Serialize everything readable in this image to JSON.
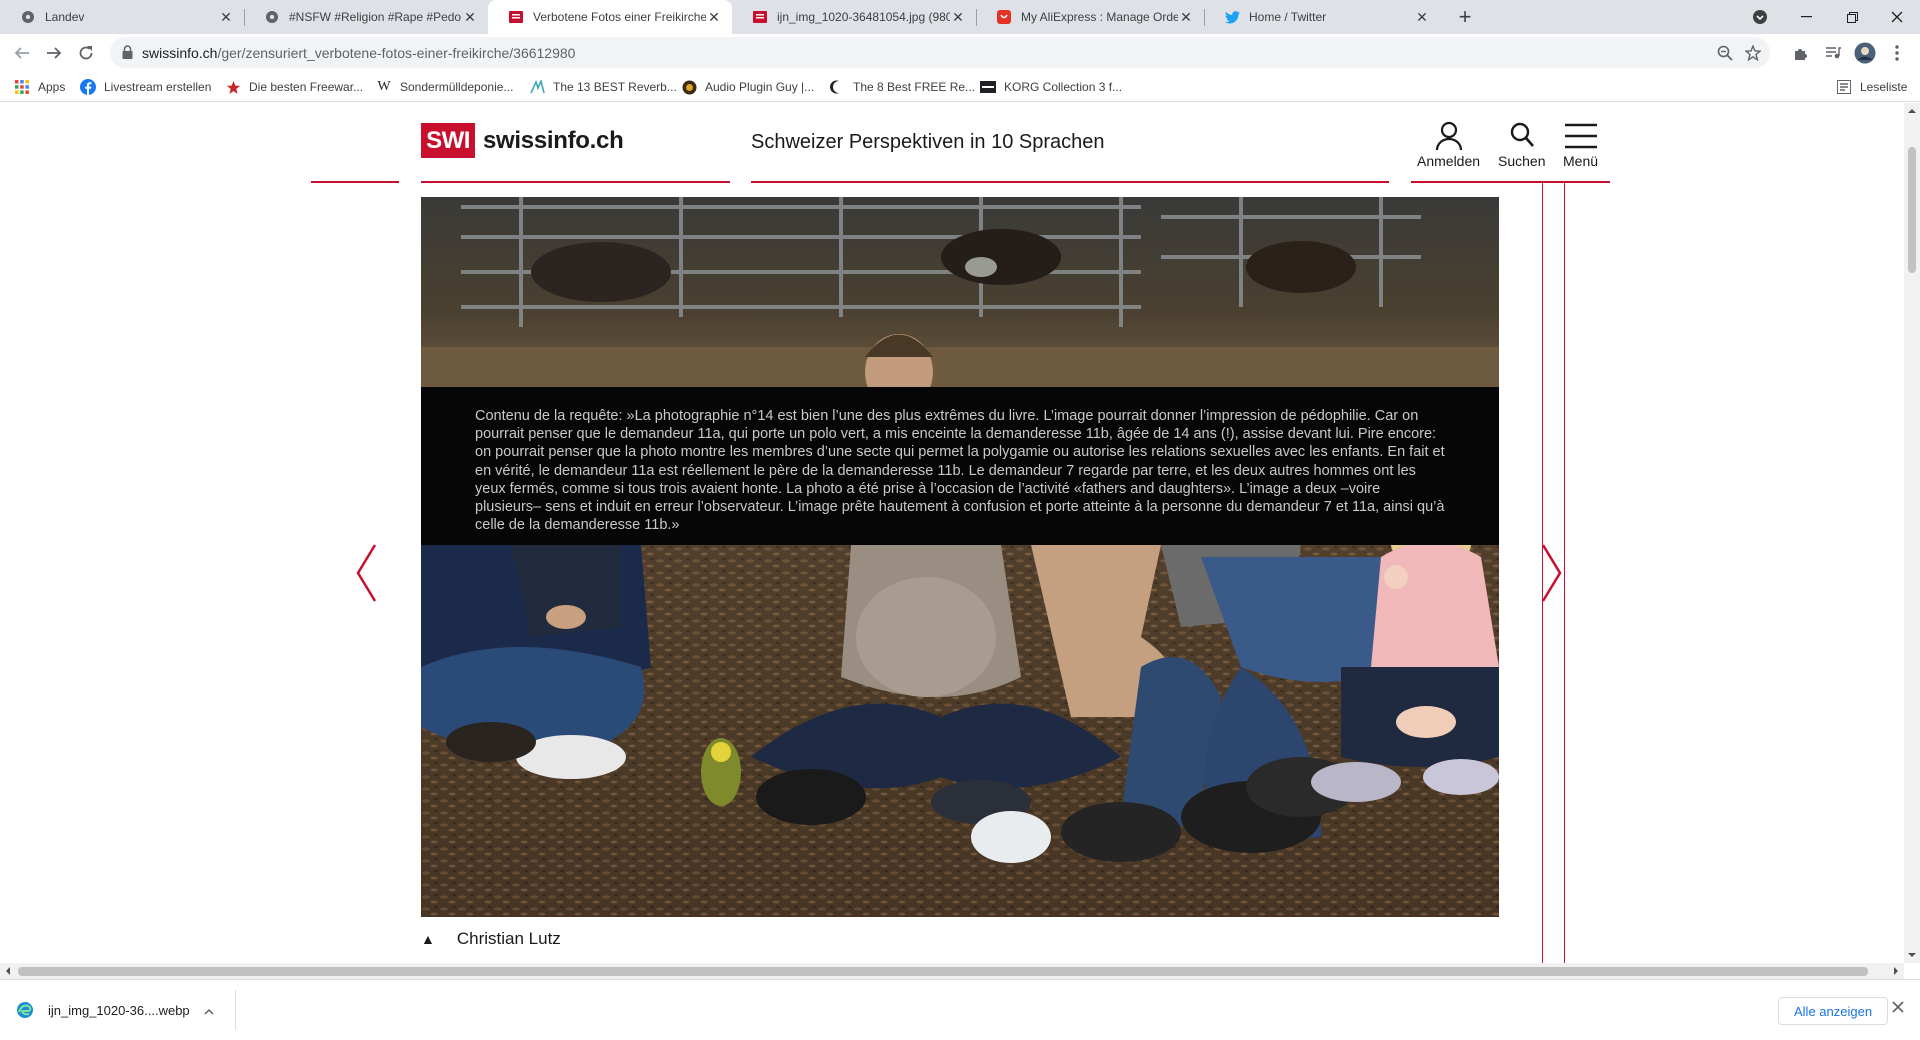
{
  "browser": {
    "tabs": [
      {
        "title": "Landev",
        "icon": "gear-icon",
        "active": false
      },
      {
        "title": "#NSFW #Religion #Rape #Pedo #",
        "icon": "gear-icon",
        "active": false
      },
      {
        "title": "Verbotene Fotos einer Freikirche",
        "icon": "swi-icon",
        "active": true
      },
      {
        "title": "ijn_img_1020-36481054.jpg (980",
        "icon": "swi-icon",
        "active": false
      },
      {
        "title": "My AliExpress : Manage Orders",
        "icon": "aliexpress-icon",
        "active": false
      },
      {
        "title": "Home / Twitter",
        "icon": "twitter-icon",
        "active": false
      }
    ],
    "url_host": "swissinfo.ch",
    "url_path": "/ger/zensuriert_verbotene-fotos-einer-freikirche/36612980",
    "bookmarks": [
      {
        "label": "Apps",
        "icon": "apps-grid-icon"
      },
      {
        "label": "Livestream erstellen",
        "icon": "facebook-icon"
      },
      {
        "label": "Die besten Freewar...",
        "icon": "star-icon"
      },
      {
        "label": "Sondermülldeponie...",
        "icon": "wikipedia-icon"
      },
      {
        "label": "The 13 BEST Reverb...",
        "icon": "plugin-icon"
      },
      {
        "label": "Audio Plugin Guy |...",
        "icon": "audio-plugin-guy-icon"
      },
      {
        "label": "The 8 Best FREE Re...",
        "icon": "moon-icon"
      },
      {
        "label": "KORG Collection 3 f...",
        "icon": "korg-icon"
      }
    ],
    "reading_list": "Leseliste"
  },
  "header": {
    "logo_box": "SWI",
    "logo_text": "swissinfo.ch",
    "tagline": "Schweizer Perspektiven in 10 Sprachen",
    "login": "Anmelden",
    "search": "Suchen",
    "menu": "Menü"
  },
  "gallery": {
    "overlay_text": "Contenu de la requête: »La photographie n°14 est bien l’une des plus extrêmes du livre. L’image pourrait donner l’impression de pédophilie. Car on pourrait penser que le demandeur 11a, qui porte un polo vert, a mis enceinte la demanderesse 11b, âgée de 14 ans (!), assise devant lui. Pire encore: on pourrait penser que la photo montre les membres d’une secte qui permet la polygamie ou autorise les relations sexuelles avec les enfants. En fait et en vérité, le demandeur 11a est réellement le père de la demanderesse 11b. Le demandeur 7 regarde par terre, et les deux autres hommes ont les yeux fermés, comme si tous trois avaient honte. La photo a été prise à l’occasion de l’activité «fathers and daughters». L’image a deux –voire plusieurs– sens et induit en erreur l’observateur. L’image prête hautement à confusion et porte atteinte à la personne du demandeur 7 et 11a, ainsi qu’à celle de la demanderesse 11b.»",
    "credit": "Christian Lutz"
  },
  "downloads": {
    "file": "ijn_img_1020-36....webp",
    "show_all": "Alle anzeigen"
  },
  "colors": {
    "swi_red": "#c8102e",
    "tabstrip": "#dee1e6"
  }
}
